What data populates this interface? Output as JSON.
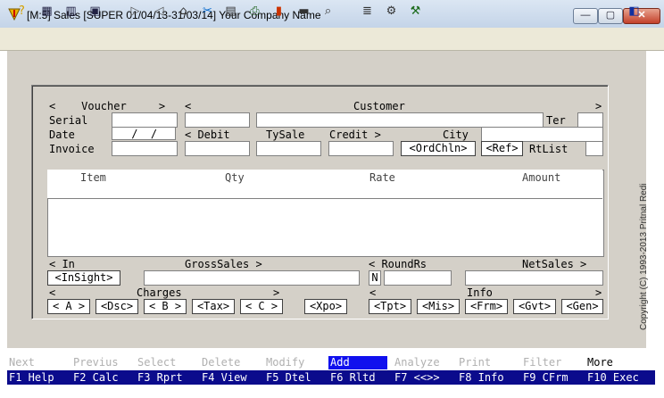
{
  "window": {
    "title": "[M:5]  Sales  [SUPER  01/04/13-31/03/14]  Your Company Name",
    "minimize": "—",
    "maximize": "▢",
    "close": "✕"
  },
  "toolbar": {
    "icons": [
      "help-icon",
      "calculator-icon",
      "report-icon",
      "view-icon",
      "play-icon",
      "back-icon",
      "home-icon",
      "tools-icon",
      "save-icon",
      "print-icon",
      "chart-icon",
      "document-icon",
      "search-icon",
      "notepad-icon",
      "settings-icon",
      "tools-icon-2",
      "exit-icon"
    ]
  },
  "form": {
    "voucher_header": "<    Voucher     >",
    "customer_header_left": "<",
    "customer_header": "Customer",
    "customer_header_right": ">",
    "serial_label": "Serial",
    "date_label": "Date",
    "date_value": " /  /",
    "invoice_label": "Invoice",
    "ter_label": "Ter",
    "debit_label": "< Debit",
    "tysale_label": "TySale",
    "credit_label": "Credit >",
    "city_label": "City",
    "ordchln_button": "<OrdChln>",
    "ref_button": "<Ref>",
    "rtlist_label": "RtList"
  },
  "grid": {
    "columns": [
      "Item",
      "Qty",
      "Rate",
      "Amount"
    ]
  },
  "totals": {
    "in_label": "< In",
    "grosssales_label": "GrossSales >",
    "insight_button": "<InSight>",
    "n_value": "N",
    "roundrs_label": "< RoundRs",
    "netsales_label": "NetSales >",
    "charges_left": "<",
    "charges_label": "Charges",
    "charges_right": ">",
    "info_left": "<",
    "info_label": "Info",
    "info_right": ">",
    "charge_buttons": [
      "< A >",
      "<Dsc>",
      "< B >",
      "<Tax>",
      "< C >",
      "<Xpo>"
    ],
    "info_buttons": [
      "<Tpt>",
      "<Mis>",
      "<Frm>",
      "<Gvt>",
      "<Gen>"
    ]
  },
  "copyright": "Copyright (C) 1993-2013  Pritnal Redi",
  "fkeys": {
    "top": [
      "Next",
      "Previus",
      "Select",
      "Delete",
      "Modify",
      "Add",
      "Analyze",
      "Print",
      "Filter",
      "More"
    ],
    "bottom": [
      "F1 Help",
      "F2 Calc",
      "F3 Rprt",
      "F4 View",
      "F5 Dtel",
      "F6 Rltd",
      "F7 <<>>",
      "F8 Info",
      "F9 CFrm",
      "F10 Exec"
    ],
    "active_index": 5
  }
}
